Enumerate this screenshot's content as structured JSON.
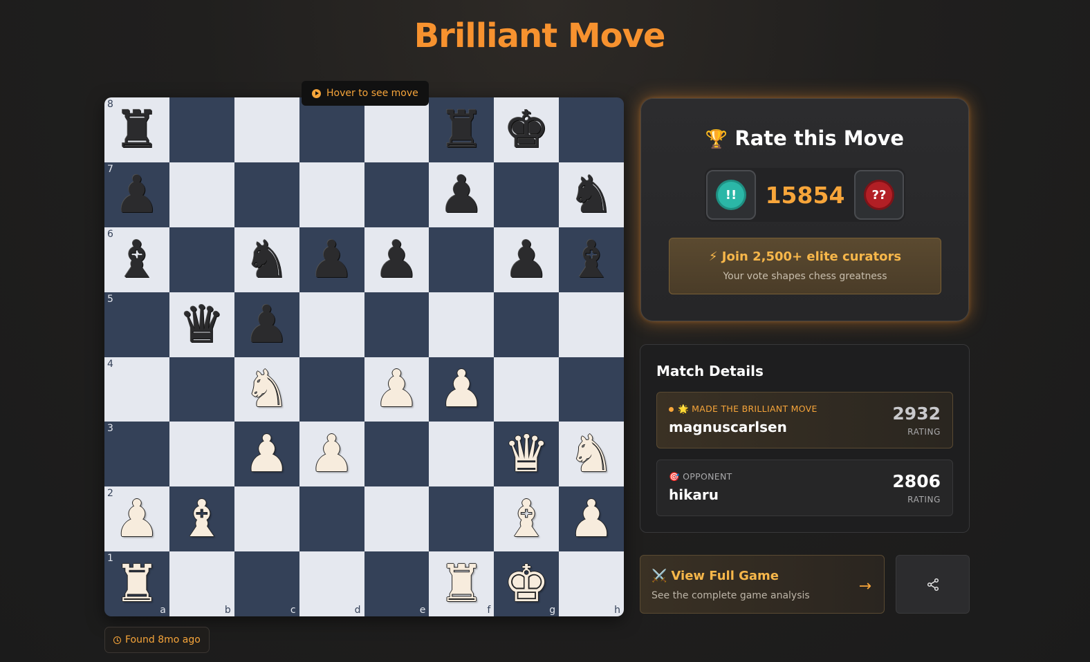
{
  "page": {
    "title": "Brilliant Move"
  },
  "board": {
    "hover_tip": "Hover to see move",
    "found": "Found 8mo ago",
    "files": [
      "a",
      "b",
      "c",
      "d",
      "e",
      "f",
      "g",
      "h"
    ],
    "ranks": [
      "8",
      "7",
      "6",
      "5",
      "4",
      "3",
      "2",
      "1"
    ],
    "position": [
      [
        "r",
        "",
        "",
        "",
        "",
        "r",
        "k",
        ""
      ],
      [
        "p",
        "",
        "",
        "",
        "",
        "p",
        "",
        "n"
      ],
      [
        "b",
        "",
        "n",
        "p",
        "p",
        "",
        "p",
        "b"
      ],
      [
        "",
        "q",
        "p",
        "",
        "",
        "",
        "",
        ""
      ],
      [
        "",
        "",
        "N",
        "",
        "P",
        "P",
        "",
        ""
      ],
      [
        "",
        "",
        "P",
        "P",
        "",
        "",
        "Q",
        "N"
      ],
      [
        "P",
        "B",
        "",
        "",
        "",
        "",
        "B",
        "P"
      ],
      [
        "R",
        "",
        "",
        "",
        "",
        "R",
        "K",
        ""
      ]
    ],
    "colors": {
      "light": "#e5e8ef",
      "dark": "#344158"
    }
  },
  "rate": {
    "title": "Rate this Move",
    "trophy_icon": "trophy-icon",
    "brilliant_badge": "!!",
    "blunder_badge": "??",
    "count": "15854",
    "join_title": "⚡ Join 2,500+ elite curators",
    "join_sub": "Your vote shapes chess greatness"
  },
  "match": {
    "title": "Match Details",
    "hero": {
      "tag": "🌟 MADE THE BRILLIANT MOVE",
      "name": "magnuscarlsen",
      "rating": "2932",
      "rating_label": "RATING"
    },
    "opponent": {
      "tag": "🎯 OPPONENT",
      "name": "hikaru",
      "rating": "2806",
      "rating_label": "RATING"
    }
  },
  "actions": {
    "full_game_title": "View Full Game",
    "full_game_icon": "⚔️",
    "full_game_sub": "See the complete game analysis",
    "share_icon": "share-icon"
  },
  "accent": "#f7922f"
}
